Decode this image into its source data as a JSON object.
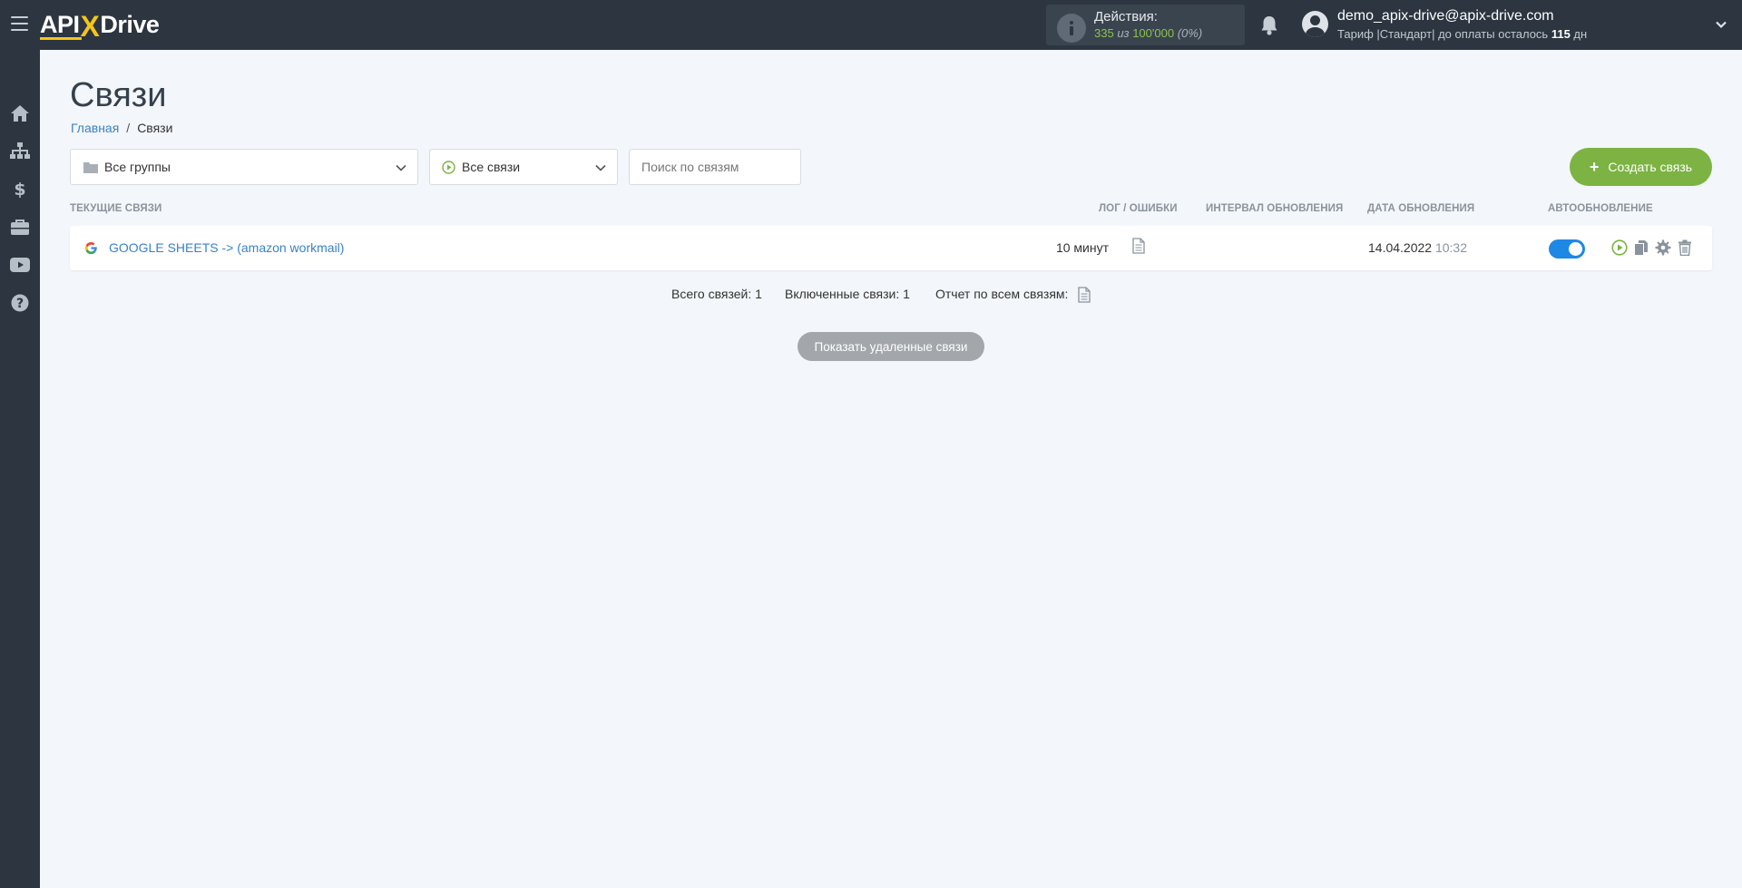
{
  "header": {
    "logo": {
      "a": "API",
      "x": "X",
      "b": "Drive"
    },
    "actions_label": "Действия:",
    "actions_used": "335",
    "actions_of": " из ",
    "actions_total": "100'000",
    "actions_pct": "(0%)",
    "email": "demo_apix-drive@apix-drive.com",
    "tariff_prefix": "Тариф |Стандарт| до оплаты осталось ",
    "tariff_days": "115",
    "tariff_suffix": " дн"
  },
  "sidebar": {
    "items": [
      {
        "icon": "home-icon"
      },
      {
        "icon": "sitemap-icon"
      },
      {
        "icon": "dollar-icon"
      },
      {
        "icon": "briefcase-icon"
      },
      {
        "icon": "youtube-icon"
      },
      {
        "icon": "question-icon"
      }
    ]
  },
  "page": {
    "title": "Связи",
    "breadcrumb_home": "Главная",
    "breadcrumb_sep": "/",
    "breadcrumb_current": "Связи"
  },
  "filters": {
    "groups_value": "Все группы",
    "links_value": "Все связи",
    "search_placeholder": "Поиск по связям",
    "create_label": "Создать связь"
  },
  "table": {
    "headers": {
      "current": "ТЕКУЩИЕ СВЯЗИ",
      "log": "ЛОГ / ОШИБКИ",
      "interval": "ИНТЕРВАЛ ОБНОВЛЕНИЯ",
      "date": "ДАТА ОБНОВЛЕНИЯ",
      "auto": "АВТООБНОВЛЕНИЕ"
    },
    "rows": [
      {
        "name": "GOOGLE SHEETS -> (amazon workmail)",
        "interval": "10 минут",
        "date": "14.04.2022",
        "time": "10:32",
        "auto_update": true
      }
    ]
  },
  "summary": {
    "total": "Всего связей: 1",
    "enabled": "Включенные связи: 1",
    "report": "Отчет по всем связям:"
  },
  "show_deleted": "Показать удаленные связи",
  "colors": {
    "topbar": "#2c3540",
    "accent_green": "#7cb342",
    "link_blue": "#3a82c4",
    "toggle_blue": "#1e88e5"
  }
}
